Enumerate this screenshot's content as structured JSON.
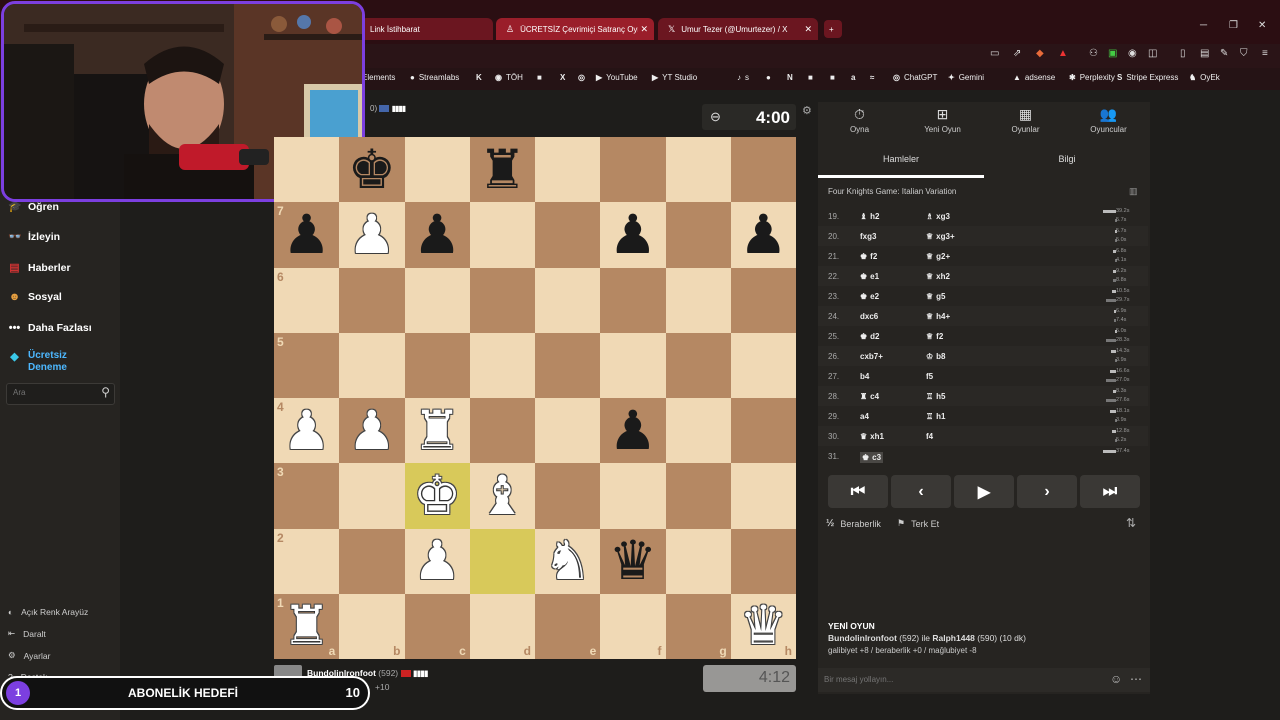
{
  "browser": {
    "tabs": [
      {
        "label": "Link İstihbarat",
        "icon": "tab-icon"
      },
      {
        "label": "ÜCRETSİZ Çevrimiçi Satranç Oyna",
        "icon": "pawn"
      },
      {
        "label": "Umur Tezer (@Umurtezer) / X",
        "icon": "X"
      }
    ],
    "new_tab": "+"
  },
  "bookmarks": [
    {
      "label": "Elements",
      "icon": ""
    },
    {
      "label": "Streamlabs",
      "icon": "●"
    },
    {
      "label": "",
      "icon": "K"
    },
    {
      "label": "TÖH",
      "icon": "◉"
    },
    {
      "label": "",
      "icon": "■"
    },
    {
      "label": "",
      "icon": "X"
    },
    {
      "label": "",
      "icon": "◎"
    },
    {
      "label": "YouTube",
      "icon": "▶"
    },
    {
      "label": "YT Studio",
      "icon": "▶"
    },
    {
      "label": "s",
      "icon": "♪"
    },
    {
      "label": "",
      "icon": "●"
    },
    {
      "label": "",
      "icon": "N"
    },
    {
      "label": "",
      "icon": "■"
    },
    {
      "label": "",
      "icon": "■"
    },
    {
      "label": "",
      "icon": "a"
    },
    {
      "label": "",
      "icon": "≈"
    },
    {
      "label": "ChatGPT",
      "icon": "◎"
    },
    {
      "label": "Gemini",
      "icon": "✦"
    },
    {
      "label": "adsense",
      "icon": "▲"
    },
    {
      "label": "Perplexity",
      "icon": "✱"
    },
    {
      "label": "Stripe Express",
      "icon": "S"
    },
    {
      "label": "OyEk",
      "icon": "♞"
    }
  ],
  "sidebar": {
    "items": [
      {
        "label": "Öğren"
      },
      {
        "label": "İzleyin"
      },
      {
        "label": "Haberler"
      },
      {
        "label": "Sosyal"
      },
      {
        "label": "Daha Fazlası"
      },
      {
        "label": "Ücretsiz Deneme"
      }
    ],
    "search_placeholder": "Ara",
    "bottom": [
      {
        "label": "Açık Renk Arayüz"
      },
      {
        "label": "Daralt"
      },
      {
        "label": "Ayarlar"
      },
      {
        "label": "Destek"
      }
    ]
  },
  "game": {
    "top_player": {
      "rating_fragment": "0)",
      "clock": "4:00"
    },
    "bottom_player": {
      "name": "Bundolinlronfoot",
      "rating": "(592)",
      "score": "+10",
      "clock": "4:12"
    },
    "board": [
      [
        "",
        "bK",
        "",
        "bR",
        "",
        "",
        "",
        ""
      ],
      [
        "bP",
        "wP",
        "bP",
        "",
        "",
        "bP",
        "",
        "bP"
      ],
      [
        "",
        "",
        "",
        "",
        "",
        "",
        "",
        ""
      ],
      [
        "",
        "",
        "",
        "",
        "",
        "",
        "",
        ""
      ],
      [
        "wP",
        "wP",
        "wR",
        "",
        "",
        "bP",
        "",
        ""
      ],
      [
        "",
        "",
        "wK",
        "wB",
        "",
        "",
        "",
        ""
      ],
      [
        "",
        "",
        "wP",
        "",
        "wN",
        "bQ",
        "",
        ""
      ],
      [
        "wR",
        "",
        "",
        "",
        "",
        "",
        "",
        "wQ"
      ]
    ],
    "highlights": [
      [
        5,
        2
      ],
      [
        6,
        3
      ]
    ],
    "ranks": [
      "7",
      "6",
      "5",
      "4",
      "3",
      "2",
      "1"
    ],
    "files": [
      "a",
      "b",
      "c",
      "d",
      "e",
      "f",
      "g",
      "h"
    ]
  },
  "panel": {
    "tabs": [
      {
        "label": "Oyna",
        "icon": "⏱"
      },
      {
        "label": "Yeni Oyun",
        "icon": "⊞"
      },
      {
        "label": "Oyunlar",
        "icon": "▦"
      },
      {
        "label": "Oyuncular",
        "icon": "👥"
      }
    ],
    "subtabs": [
      "Hamleler",
      "Bilgi"
    ],
    "opening": "Four Knights Game: Italian Variation",
    "moves": [
      {
        "n": "19.",
        "w": "h2",
        "wi": "♝",
        "b": "xg3",
        "bi": "♗",
        "tw": "39.2s",
        "tb": "5.7s",
        "bw": 0.9,
        "bb": 0.1
      },
      {
        "n": "20.",
        "w": "fxg3",
        "wi": "",
        "b": "xg3+",
        "bi": "♕",
        "tw": "5.7s",
        "tb": "5.0s",
        "bw": 0.1,
        "bb": 0.1
      },
      {
        "n": "21.",
        "w": "f2",
        "wi": "♚",
        "b": "g2+",
        "bi": "♕",
        "tw": "6.8s",
        "tb": "4.1s",
        "bw": 0.2,
        "bb": 0.1
      },
      {
        "n": "22.",
        "w": "e1",
        "wi": "♚",
        "b": "xh2",
        "bi": "♕",
        "tw": "9.2s",
        "tb": "8.8s",
        "bw": 0.25,
        "bb": 0.2
      },
      {
        "n": "23.",
        "w": "e2",
        "wi": "♚",
        "b": "g5",
        "bi": "♕",
        "tw": "10.5s",
        "tb": "29.7s",
        "bw": 0.3,
        "bb": 0.7
      },
      {
        "n": "24.",
        "w": "dxc6",
        "wi": "",
        "b": "h4+",
        "bi": "♕",
        "tw": "6.9s",
        "tb": "7.4s",
        "bw": 0.15,
        "bb": 0.15
      },
      {
        "n": "25.",
        "w": "d2",
        "wi": "♚",
        "b": "f2",
        "bi": "♕",
        "tw": "5.0s",
        "tb": "28.3s",
        "bw": 0.1,
        "bb": 0.7
      },
      {
        "n": "26.",
        "w": "cxb7+",
        "wi": "",
        "b": "b8",
        "bi": "♔",
        "tw": "14.3s",
        "tb": "3.9s",
        "bw": 0.35,
        "bb": 0.1
      },
      {
        "n": "27.",
        "w": "b4",
        "wi": "",
        "b": "f5",
        "bi": "",
        "tw": "16.6s",
        "tb": "27.0s",
        "bw": 0.4,
        "bb": 0.7
      },
      {
        "n": "28.",
        "w": "c4",
        "wi": "♜",
        "b": "h5",
        "bi": "♖",
        "tw": "8.3s",
        "tb": "27.6s",
        "bw": 0.2,
        "bb": 0.7
      },
      {
        "n": "29.",
        "w": "a4",
        "wi": "",
        "b": "h1",
        "bi": "♖",
        "tw": "18.1s",
        "tb": "3.9s",
        "bw": 0.45,
        "bb": 0.1
      },
      {
        "n": "30.",
        "w": "xh1",
        "wi": "♛",
        "b": "f4",
        "bi": "",
        "tw": "12.8s",
        "tb": "5.2s",
        "bw": 0.3,
        "bb": 0.1
      },
      {
        "n": "31.",
        "w": "c3",
        "wi": "♚",
        "b": "",
        "bi": "",
        "tw": "37.4s",
        "tb": "",
        "bw": 0.9,
        "bb": 0
      }
    ],
    "controls": [
      "⏮",
      "‹",
      "▶",
      "›",
      "⏭"
    ],
    "draw": "Beraberlik",
    "draw_icon": "½",
    "resign": "Terk Et",
    "resign_icon": "⚑",
    "new_game_title": "YENİ OYUN",
    "new_game_p1": "Bundolinlronfoot",
    "new_game_p1_rating": "(592) ile",
    "new_game_p2": "Ralph1448",
    "new_game_p2_rating": "(590) (10 dk)",
    "new_game_stats": "galibiyet +8 / beraberlik +0 / mağlubiyet -8",
    "chat_placeholder": "Bir mesaj yollayın..."
  },
  "overlay": {
    "left_num": "1",
    "title": "ABONELİK HEDEFİ",
    "right_num": "10"
  },
  "colors": {
    "accent_purple": "#7c3fe0",
    "light_square": "#f0d9b5",
    "dark_square": "#b58863",
    "highlight": "#d8c95a"
  }
}
